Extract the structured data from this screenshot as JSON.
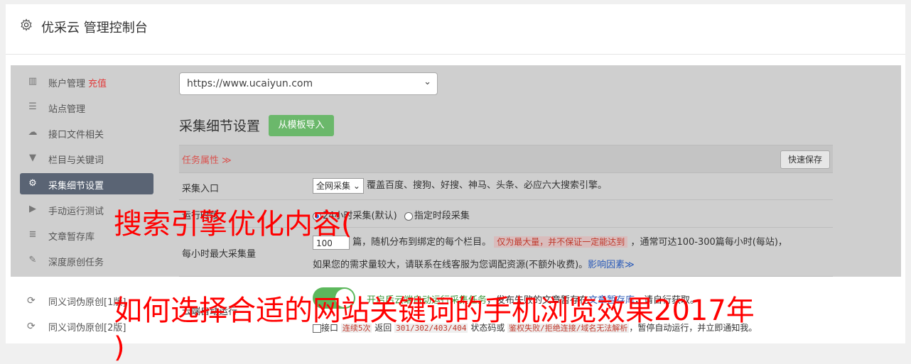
{
  "header": {
    "title": "优采云 管理控制台",
    "icon": "gear-icon"
  },
  "sidebar": {
    "items": [
      {
        "label": "账户管理",
        "badge": "充值",
        "icon": "bar-chart-icon"
      },
      {
        "label": "站点管理",
        "icon": "server-icon"
      },
      {
        "label": "接口文件相关",
        "icon": "cloud-upload-icon"
      },
      {
        "label": "栏目与关键词",
        "icon": "filter-icon"
      },
      {
        "label": "采集细节设置",
        "icon": "gears-icon",
        "active": true
      },
      {
        "label": "手动运行测试",
        "icon": "play-icon"
      },
      {
        "label": "文章暂存库",
        "icon": "database-icon"
      },
      {
        "label": "深度原创任务",
        "icon": "edit-icon"
      },
      {
        "label": "同义词伪原创[1版]",
        "icon": "refresh-icon"
      },
      {
        "label": "同义词伪原创[2版]",
        "icon": "refresh-icon"
      }
    ]
  },
  "main": {
    "site_select": "https://www.ucaiyun.com",
    "section_title": "采集细节设置",
    "template_button": "从模板导入",
    "task_label": "任务属性 ≫",
    "save_button": "快速保存",
    "rows": {
      "entry_label": "采集入口",
      "entry_select": "全网采集",
      "entry_desc": "覆盖百度、搜狗、好搜、神马、头条、必应六大搜索引擎。",
      "time_label": "运行时段",
      "time_opt1": "24小时采集(默认)",
      "time_opt2": "指定时段采集",
      "max_label": "每小时最大采集量",
      "max_value": "100",
      "max_unit": "篇，随机分布到绑定的每个栏目。",
      "max_tag": "仅为最大量，并不保证一定能达到",
      "max_tail": "，通常可达100-300篇每小时(每站)，",
      "max_line2": "如果您的需求量较大，请联系在线客服为您调配资源(不额外收费)。",
      "max_link": "影响因素≫",
      "auto_label": "云端自动运行",
      "auto_desc_green": "开启后云端自动运行采集任务",
      "auto_desc": "，发布失败的文章暂存在",
      "auto_link": "文章暂存库",
      "auto_tail": "，请自行获取。",
      "api_prefix": "接口",
      "api_code1": "连续5次",
      "api_mid": "返回",
      "api_code2": "301/302/403/404",
      "api_mid2": "状态码或",
      "api_code3": "鉴权失败/拒绝连接/域名无法解析",
      "api_tail": "，暂停自动运行，并立即通知我。"
    }
  },
  "overlay": {
    "line1": "搜索引擎优化内容(",
    "line2": "如何选择合适的网站关键词的手机浏览效果2017年",
    "line3": ")"
  }
}
